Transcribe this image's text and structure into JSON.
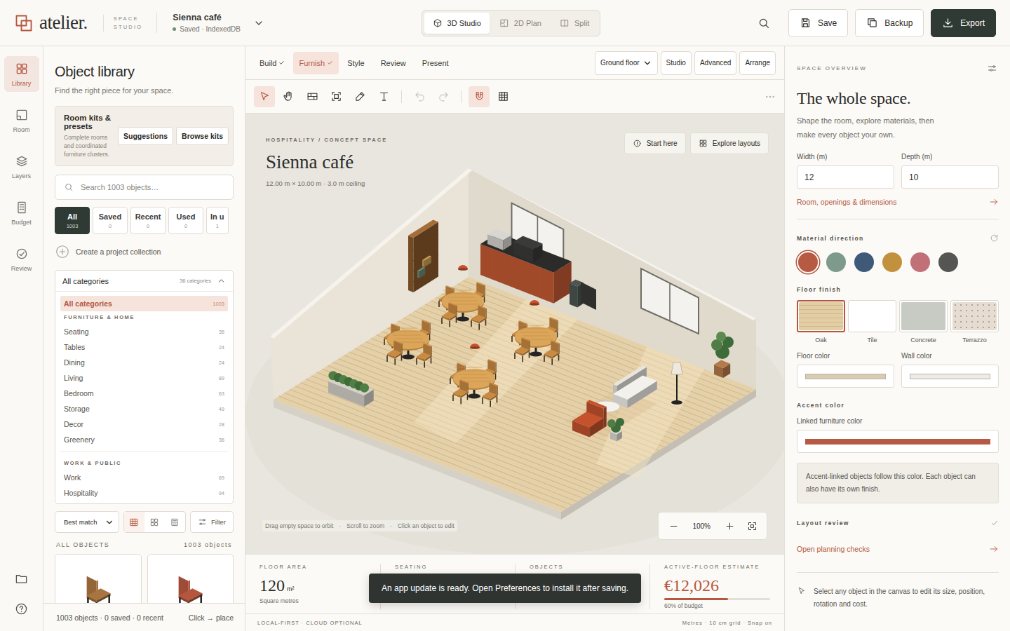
{
  "header": {
    "logo": "atelier.",
    "product": [
      "SPACE",
      "STUDIO"
    ],
    "project": {
      "name": "Sienna café",
      "status": "Saved · IndexedDB",
      "saved": true
    },
    "view_modes": [
      {
        "label": "3D Studio",
        "selected": true
      },
      {
        "label": "2D Plan",
        "selected": false
      },
      {
        "label": "Split",
        "selected": false
      }
    ],
    "actions": [
      {
        "label": "Save",
        "kind": "outline"
      },
      {
        "label": "Backup",
        "kind": "outline"
      },
      {
        "label": "Export",
        "kind": "primary"
      }
    ]
  },
  "rail": {
    "items": [
      {
        "label": "Library",
        "selected": true
      },
      {
        "label": "Room",
        "selected": false
      },
      {
        "label": "Layers",
        "selected": false
      },
      {
        "label": "Budget",
        "selected": false
      },
      {
        "label": "Review",
        "selected": false
      }
    ]
  },
  "library": {
    "title": "Object library",
    "subtitle": "Find the right piece for your space.",
    "kits": {
      "title": "Room kits & presets",
      "description": "Complete rooms and coordinated furniture clusters.",
      "buttons": [
        "Suggestions",
        "Browse kits"
      ]
    },
    "search": {
      "placeholder": "Search 1003 objects…"
    },
    "chips": [
      {
        "label": "All",
        "count": "1003",
        "selected": true
      },
      {
        "label": "Saved",
        "count": "0",
        "selected": false
      },
      {
        "label": "Recent",
        "count": "0",
        "selected": false
      },
      {
        "label": "Used",
        "count": "0",
        "selected": false
      },
      {
        "label": "In u",
        "count": "1",
        "selected": false
      }
    ],
    "collection": "Create a project collection",
    "categories": {
      "header": "All categories",
      "summary": "36 categories",
      "expanded": true,
      "all": {
        "label": "All categories",
        "count": "1003",
        "selected": true
      },
      "groups": [
        {
          "title": "FURNITURE & HOME",
          "items": [
            {
              "label": "Seating",
              "count": "35",
              "selected": false
            },
            {
              "label": "Tables",
              "count": "24",
              "selected": false
            },
            {
              "label": "Dining",
              "count": "24",
              "selected": false
            },
            {
              "label": "Living",
              "count": "89",
              "selected": false
            },
            {
              "label": "Bedroom",
              "count": "63",
              "selected": false
            },
            {
              "label": "Storage",
              "count": "49",
              "selected": false
            },
            {
              "label": "Decor",
              "count": "28",
              "selected": false
            },
            {
              "label": "Greenery",
              "count": "36",
              "selected": false
            }
          ]
        },
        {
          "title": "WORK & PUBLIC",
          "items": [
            {
              "label": "Work",
              "count": "69",
              "selected": false
            },
            {
              "label": "Hospitality",
              "count": "94",
              "selected": false
            }
          ]
        }
      ]
    },
    "sort": "Best match",
    "views": [
      {
        "selected": true
      },
      {
        "selected": false
      },
      {
        "selected": false
      }
    ],
    "filter": "Filter",
    "results": {
      "label": "ALL OBJECTS",
      "count": "1003 objects"
    },
    "items": [
      {
        "color": "#a8743f"
      },
      {
        "color": "#b5573f"
      }
    ],
    "footer": {
      "summary": "1003 objects · 0 saved · 0 recent",
      "hint": "Click → place"
    }
  },
  "workspace": {
    "modes": [
      {
        "label": "Build",
        "done": true,
        "selected": false
      },
      {
        "label": "Furnish",
        "done": true,
        "selected": true
      },
      {
        "label": "Style",
        "done": false,
        "selected": false
      },
      {
        "label": "Review",
        "done": false,
        "selected": false
      },
      {
        "label": "Present",
        "done": false,
        "selected": false
      }
    ],
    "floor": "Ground floor",
    "panels": [
      "Studio",
      "Advanced",
      "Arrange"
    ],
    "tools": [
      {
        "selected": true,
        "disabled": false
      },
      {
        "selected": false,
        "disabled": false
      },
      {
        "selected": false,
        "disabled": false
      },
      {
        "selected": false,
        "disabled": false
      },
      {
        "selected": false,
        "disabled": false
      },
      {
        "selected": false,
        "disabled": false
      },
      {
        "selected": false,
        "disabled": true
      },
      {
        "selected": false,
        "disabled": true
      },
      {
        "selected": true,
        "disabled": false
      },
      {
        "selected": false,
        "disabled": false
      }
    ]
  },
  "canvas": {
    "eyebrow": "HOSPITALITY / CONCEPT SPACE",
    "title": "Sienna café",
    "meta": "12.00 m × 10.00 m · 3.0 m ceiling",
    "buttons": [
      "Start here",
      "Explore layouts"
    ],
    "hints": [
      "Drag empty space to orbit",
      "Scroll to zoom",
      "Click an object to edit"
    ],
    "hint_separator": "·",
    "zoom": "100%"
  },
  "stats": [
    {
      "kind": "value",
      "label": "FLOOR AREA",
      "value": "120",
      "unit": "m²",
      "note": "Square metres"
    },
    {
      "kind": "covered",
      "label": "SEATING"
    },
    {
      "kind": "covered",
      "label": "OBJECTS"
    },
    {
      "kind": "budget",
      "label": "ACTIVE-FLOOR ESTIMATE",
      "value": "€12,026",
      "level": 0.6,
      "note": "60% of budget"
    }
  ],
  "toast": "An app update is ready. Open Preferences to install it after saving.",
  "status_bar": {
    "left": "LOCAL-FIRST · CLOUD OPTIONAL",
    "right": "Metres · 10 cm grid · Snap on"
  },
  "inspector": {
    "eyebrow": "SPACE OVERVIEW",
    "title": "The whole space.",
    "description": "Shape the room, explore materials, then make every object your own.",
    "fields": [
      {
        "label": "Width (m)",
        "value": "12"
      },
      {
        "label": "Depth (m)",
        "value": "10"
      }
    ],
    "room_link": "Room, openings & dimensions",
    "material": {
      "label": "Material direction",
      "swatches": [
        {
          "color": "#b65a43",
          "selected": true
        },
        {
          "color": "#7d9a8a",
          "selected": false
        },
        {
          "color": "#3e5a78",
          "selected": false
        },
        {
          "color": "#c2913e",
          "selected": false
        },
        {
          "color": "#c27078",
          "selected": false
        },
        {
          "color": "#555553",
          "selected": false
        }
      ]
    },
    "floor_finish": {
      "label": "Floor finish",
      "options": [
        {
          "label": "Oak",
          "kind": "oak",
          "selected": true
        },
        {
          "label": "Tile",
          "kind": "tile",
          "selected": false
        },
        {
          "label": "Concrete",
          "kind": "concrete",
          "selected": false
        },
        {
          "label": "Terrazzo",
          "kind": "terrazzo",
          "selected": false
        }
      ]
    },
    "colors": [
      {
        "label": "Floor color",
        "color": "#d8ccb0"
      },
      {
        "label": "Wall color",
        "color": "#ecebe6"
      }
    ],
    "accent": {
      "label": "Accent color",
      "field_label": "Linked furniture color",
      "color": "#b65a43",
      "note": "Accent-linked objects follow this color. Each object can also have its own finish."
    },
    "review": {
      "label": "Layout review",
      "done": true,
      "link": "Open planning checks"
    },
    "hint": "Select any object in the canvas to edit its size, position, rotation and cost."
  }
}
